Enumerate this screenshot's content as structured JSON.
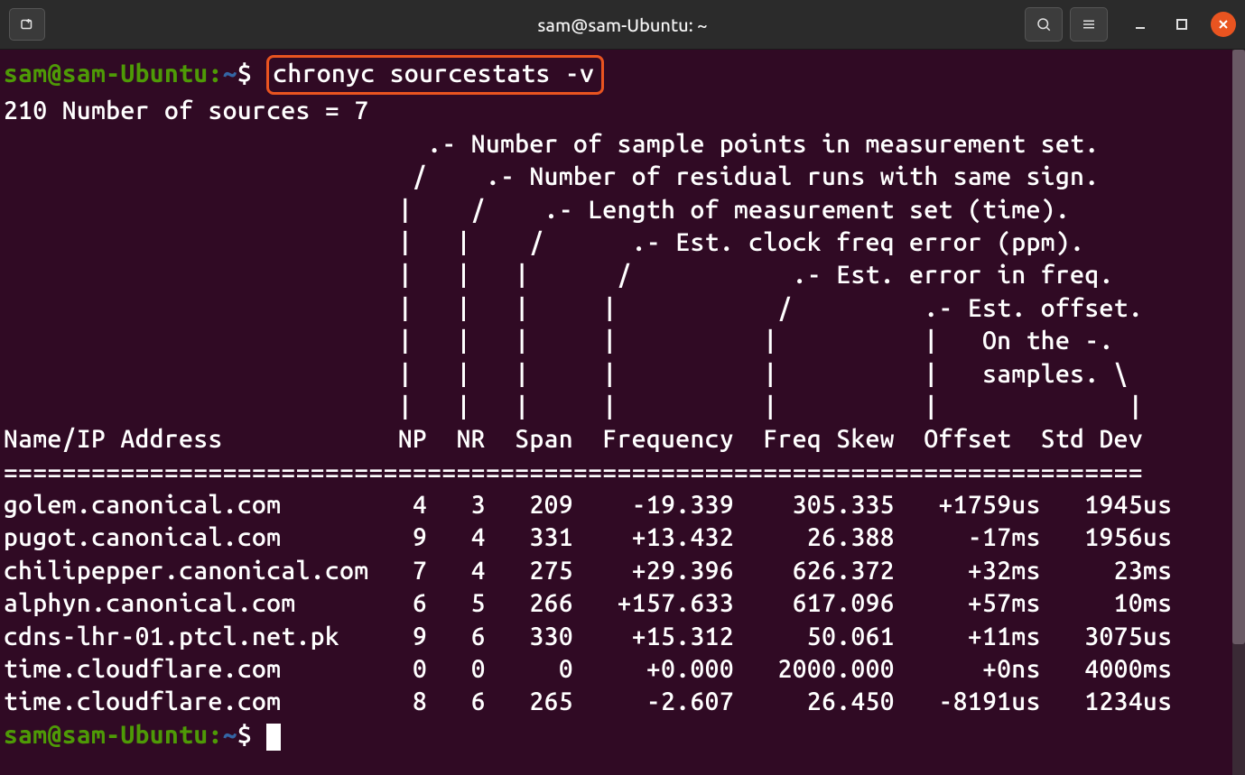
{
  "window": {
    "title": "sam@sam-Ubuntu: ~"
  },
  "prompt": {
    "userhost": "sam@sam-Ubuntu",
    "sep1": ":",
    "path": "~",
    "dollar": "$"
  },
  "command": "chronyc sourcestats -v",
  "output": {
    "sources_line": "210 Number of sources = 7",
    "legend": [
      "                             .- Number of sample points in measurement set.",
      "                            /    .- Number of residual runs with same sign.",
      "                           |    /    .- Length of measurement set (time).",
      "                           |   |    /      .- Est. clock freq error (ppm).",
      "                           |   |   |      /           .- Est. error in freq.",
      "                           |   |   |     |           /         .- Est. offset.",
      "                           |   |   |     |          |          |   On the -.",
      "                           |   |   |     |          |          |   samples. \\",
      "                           |   |   |     |          |          |             |"
    ],
    "header": "Name/IP Address            NP  NR  Span  Frequency  Freq Skew  Offset  Std Dev",
    "divider": "==============================================================================",
    "rows": [
      {
        "name": "golem.canonical.com",
        "np": "4",
        "nr": "3",
        "span": "209",
        "freq": "-19.339",
        "skew": "305.335",
        "offset": "+1759us",
        "stddev": "1945us"
      },
      {
        "name": "pugot.canonical.com",
        "np": "9",
        "nr": "4",
        "span": "331",
        "freq": "+13.432",
        "skew": "26.388",
        "offset": "-17ms",
        "stddev": "1956us"
      },
      {
        "name": "chilipepper.canonical.com",
        "np": "7",
        "nr": "4",
        "span": "275",
        "freq": "+29.396",
        "skew": "626.372",
        "offset": "+32ms",
        "stddev": "23ms"
      },
      {
        "name": "alphyn.canonical.com",
        "np": "6",
        "nr": "5",
        "span": "266",
        "freq": "+157.633",
        "skew": "617.096",
        "offset": "+57ms",
        "stddev": "10ms"
      },
      {
        "name": "cdns-lhr-01.ptcl.net.pk",
        "np": "9",
        "nr": "6",
        "span": "330",
        "freq": "+15.312",
        "skew": "50.061",
        "offset": "+11ms",
        "stddev": "3075us"
      },
      {
        "name": "time.cloudflare.com",
        "np": "0",
        "nr": "0",
        "span": "0",
        "freq": "+0.000",
        "skew": "2000.000",
        "offset": "+0ns",
        "stddev": "4000ms"
      },
      {
        "name": "time.cloudflare.com",
        "np": "8",
        "nr": "6",
        "span": "265",
        "freq": "-2.607",
        "skew": "26.450",
        "offset": "-8191us",
        "stddev": "1234us"
      }
    ]
  }
}
